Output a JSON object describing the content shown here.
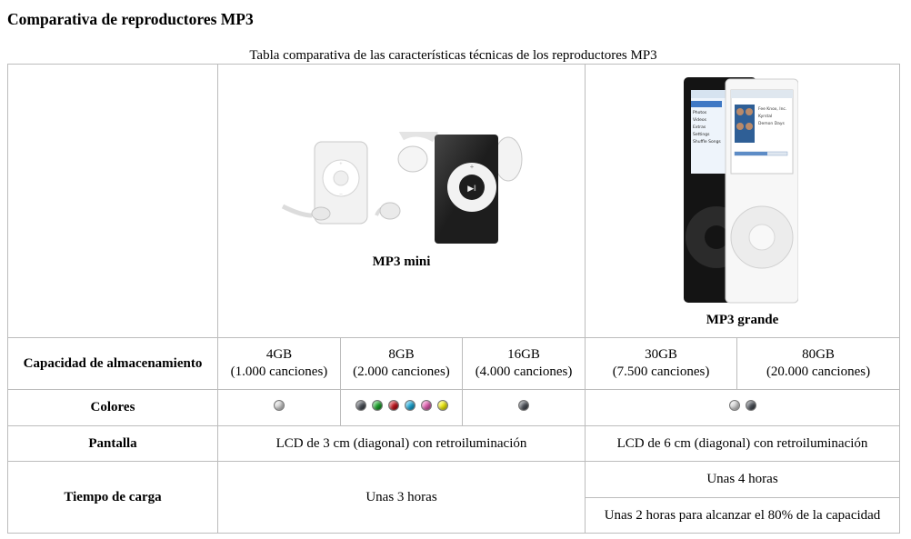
{
  "page": {
    "title": "Comparativa de reproductores MP3",
    "caption": "Tabla comparativa de las características técnicas de los reproductores MP3"
  },
  "models": {
    "mini": {
      "label": "MP3 mini"
    },
    "grande": {
      "label": "MP3 grande"
    }
  },
  "rows": {
    "capacity": {
      "label": "Capacidad de almacenamiento",
      "values": [
        {
          "size": "4GB",
          "songs": "(1.000 canciones)"
        },
        {
          "size": "8GB",
          "songs": "(2.000 canciones)"
        },
        {
          "size": "16GB",
          "songs": "(4.000 canciones)"
        },
        {
          "size": "30GB",
          "songs": "(7.500 canciones)"
        },
        {
          "size": "80GB",
          "songs": "(20.000 canciones)"
        }
      ]
    },
    "colors": {
      "label": "Colores",
      "swatches": [
        [
          "#d8d8d8"
        ],
        [
          "#4a4f57",
          "#1aa52a",
          "#c0101a",
          "#19a8d8",
          "#e35bb0",
          "#f2ee0a"
        ],
        [
          "#4a4f57"
        ],
        [
          "#d8d8d8",
          "#4a4f57"
        ],
        []
      ]
    },
    "screen": {
      "label": "Pantalla",
      "mini": "LCD de 3 cm (diagonal) con retroiluminación",
      "grande": "LCD de 6 cm (diagonal) con retroiluminación"
    },
    "charge": {
      "label": "Tiempo de carga",
      "mini": "Unas 3 horas",
      "grande_full": "Unas 4 horas",
      "grande_partial": "Unas 2 horas para alcanzar el 80% de la capacidad"
    }
  }
}
